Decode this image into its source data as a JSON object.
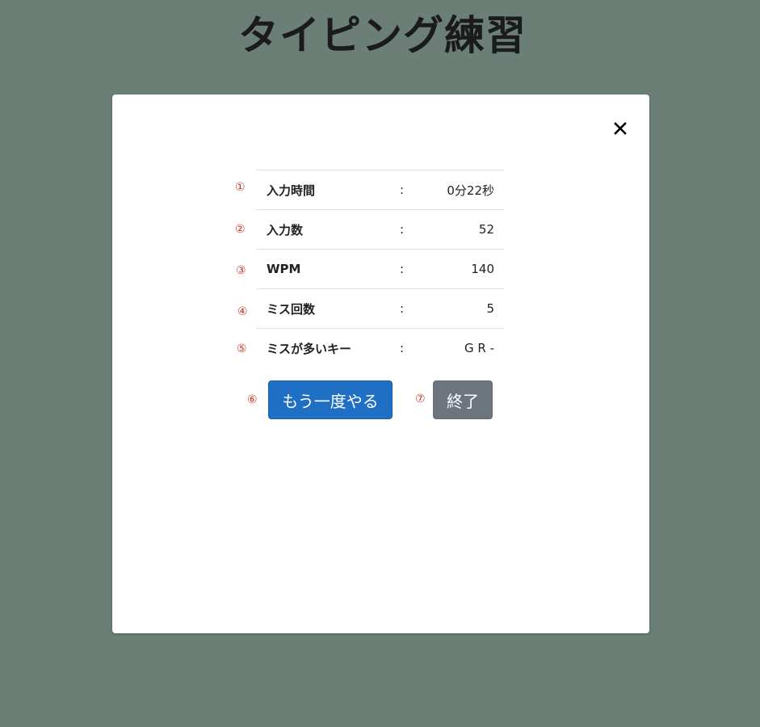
{
  "page": {
    "title": "タイピング練習"
  },
  "modal": {
    "close_icon": "close-icon",
    "separator": ":",
    "results": [
      {
        "marker": "①",
        "label": "入力時間",
        "value": "0分22秒"
      },
      {
        "marker": "②",
        "label": "入力数",
        "value": "52"
      },
      {
        "marker": "③",
        "label": "WPM",
        "value": "140"
      },
      {
        "marker": "④",
        "label": "ミス回数",
        "value": "5"
      },
      {
        "marker": "⑤",
        "label": "ミスが多いキー",
        "value": "G R -"
      }
    ],
    "buttons": {
      "retry_marker": "⑥",
      "retry_label": "もう一度やる",
      "quit_marker": "⑦",
      "quit_label": "終了"
    }
  },
  "colors": {
    "background": "#6b7f77",
    "primary": "#1f6fc4",
    "secondary": "#6c757d",
    "marker": "#c0392b"
  }
}
